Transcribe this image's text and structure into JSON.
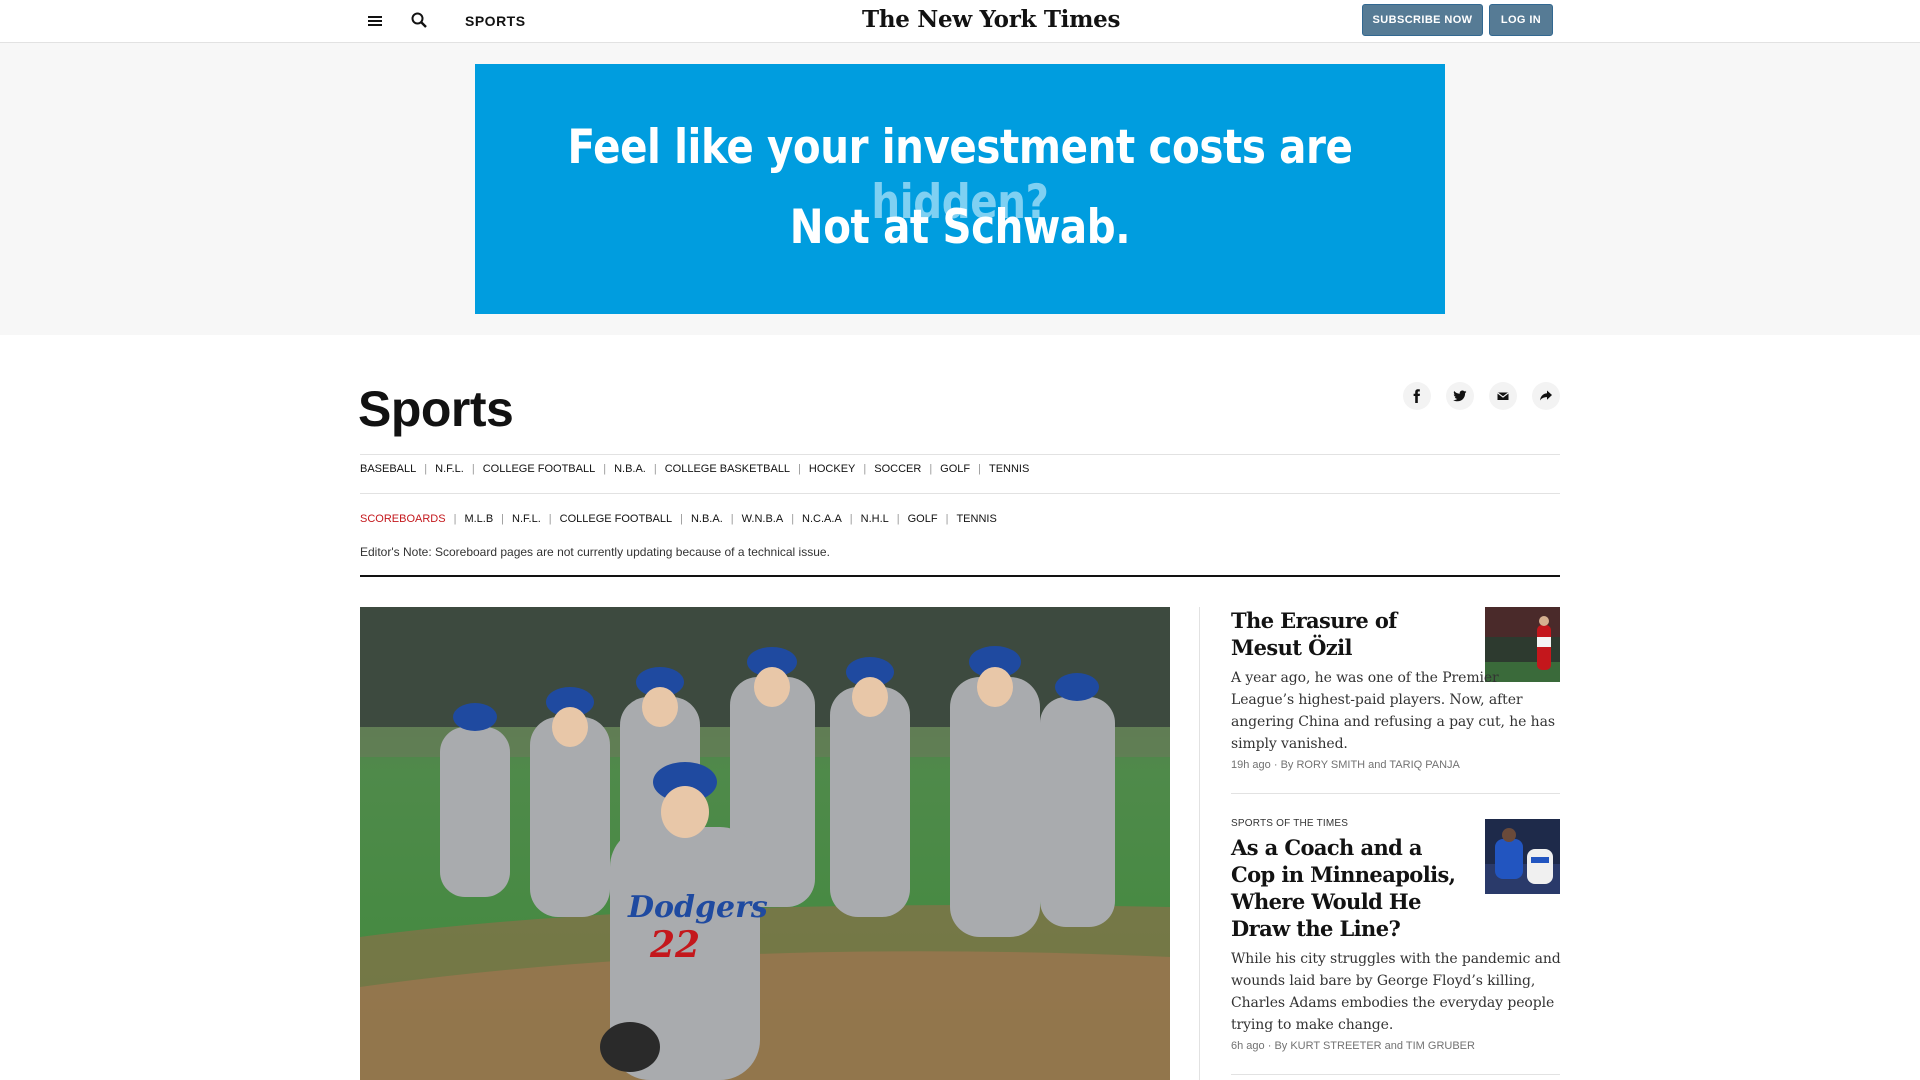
{
  "header": {
    "section_label": "SPORTS",
    "logo_text": "The New York Times",
    "subscribe_label": "SUBSCRIBE NOW",
    "login_label": "LOG IN"
  },
  "ad": {
    "line1_main": "Feel like your investment costs are",
    "line1_highlight": "hidden?",
    "line2": "Not at Schwab."
  },
  "page": {
    "title": "Sports",
    "share_icons": [
      "facebook-icon",
      "twitter-icon",
      "email-icon",
      "share-icon"
    ]
  },
  "nav_primary": [
    "BASEBALL",
    "N.F.L.",
    "COLLEGE FOOTBALL",
    "N.B.A.",
    "COLLEGE BASKETBALL",
    "HOCKEY",
    "SOCCER",
    "GOLF",
    "TENNIS"
  ],
  "nav_scoreboards": [
    "SCOREBOARDS",
    "M.L.B",
    "N.F.L.",
    "COLLEGE FOOTBALL",
    "N.B.A.",
    "W.N.B.A",
    "N.C.A.A",
    "N.H.L",
    "GOLF",
    "TENNIS"
  ],
  "editor_note": "Editor's Note: Scoreboard pages are not currently updating because of a technical issue.",
  "stories": [
    {
      "kicker": "",
      "title": "The Erasure of Mesut Özil",
      "summary": "A year ago, he was one of the Premier League’s highest-paid players. Now, after angering China and refusing a pay cut, he has simply vanished.",
      "time": "19h ago",
      "byline": "By RORY SMITH and TARIQ PANJA"
    },
    {
      "kicker": "SPORTS OF THE TIMES",
      "title": "As a Coach and a Cop in Minneapolis, Where Would He Draw the Line?",
      "summary": "While his city struggles with the pandemic and wounds laid bare by George Floyd’s killing, Charles Adams embodies the everyday people trying to make change.",
      "time": "6h ago",
      "byline": "By KURT STREETER and TIM GRUBER"
    }
  ],
  "colors": {
    "ad_background": "#009ddf",
    "button_background": "#567b95",
    "scoreboards_red": "#c4171c"
  },
  "hero_image": {
    "jersey_number": "22",
    "team_text": "Dodgers"
  }
}
